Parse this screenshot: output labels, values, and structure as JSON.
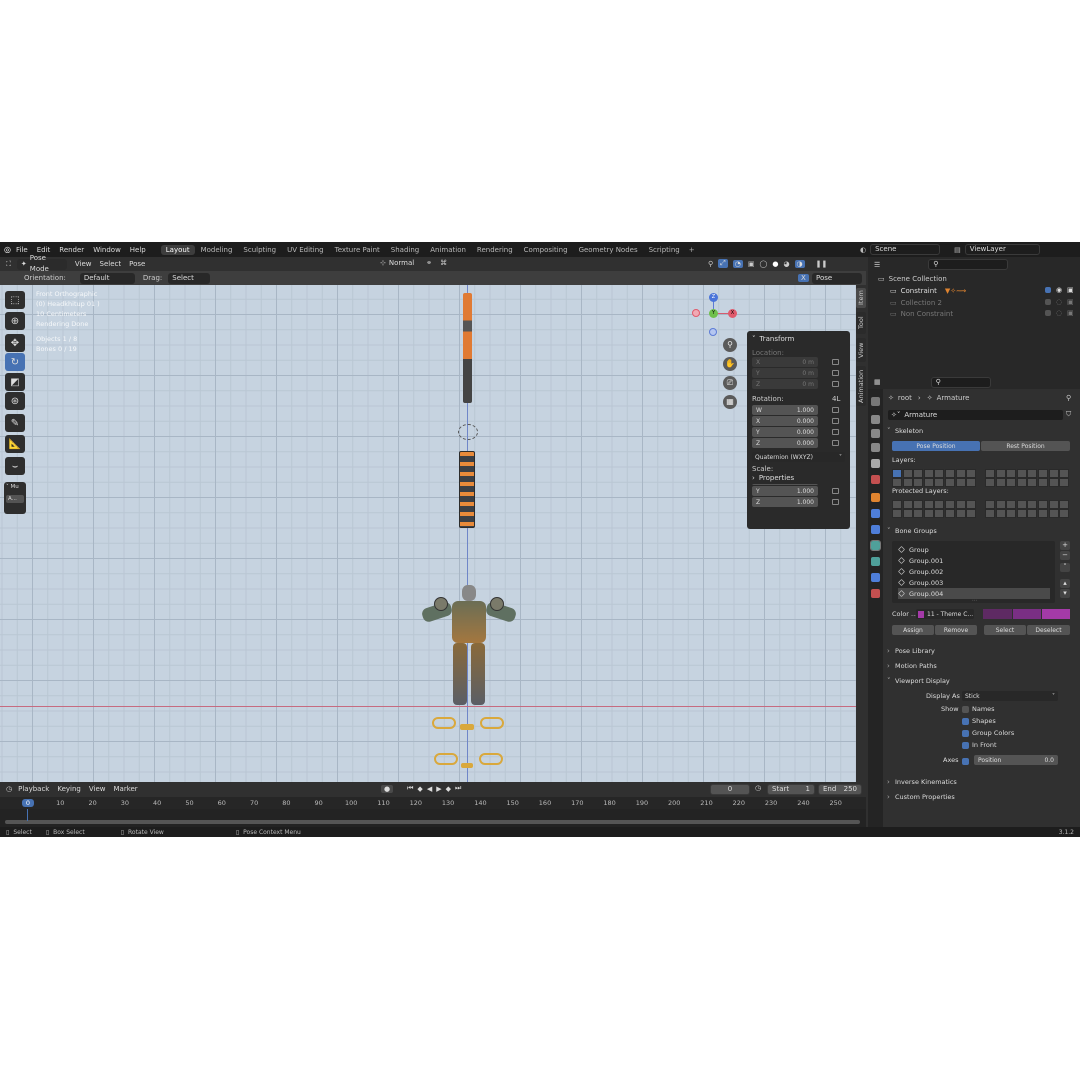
{
  "menu": [
    "File",
    "Edit",
    "Render",
    "Window",
    "Help"
  ],
  "workspaces": [
    "Layout",
    "Modeling",
    "Sculpting",
    "UV Editing",
    "Texture Paint",
    "Shading",
    "Animation",
    "Rendering",
    "Compositing",
    "Geometry Nodes",
    "Scripting"
  ],
  "active_workspace": "Layout",
  "add_workspace": "+",
  "scene": "Scene",
  "view_layer": "ViewLayer",
  "header": {
    "mode": "Pose Mode",
    "menus": [
      "View",
      "Select",
      "Pose"
    ],
    "pivot": "Normal"
  },
  "tool_header": {
    "orientation_label": "Orientation:",
    "orientation": "Default",
    "drag_label": "Drag:",
    "drag": "Select Box",
    "pose_options": "Pose Options",
    "x_label": "X"
  },
  "overlay_info": [
    "Front Orthographic",
    "(0) Headkhitup 01 )",
    "10 Centimeters",
    "Rendering Done",
    "",
    "Objects    1 / 8",
    "Bones      0 / 19"
  ],
  "gizmo": {
    "z": "Z",
    "y": "Y",
    "x": "X"
  },
  "last_op": "Mu",
  "last_op_short": "A...",
  "transform": {
    "title": "Transform",
    "location_label": "Location:",
    "location": [
      {
        "axis": "X",
        "value": "0 m"
      },
      {
        "axis": "Y",
        "value": "0 m"
      },
      {
        "axis": "Z",
        "value": "0 m"
      }
    ],
    "rotation_label": "Rotation:",
    "rotation_mode_short": "4L",
    "rotation": [
      {
        "axis": "W",
        "value": "1.000"
      },
      {
        "axis": "X",
        "value": "0.000"
      },
      {
        "axis": "Y",
        "value": "0.000"
      },
      {
        "axis": "Z",
        "value": "0.000"
      }
    ],
    "rotation_mode": "Quaternion (WXYZ)",
    "scale_label": "Scale:",
    "scale": [
      {
        "axis": "X",
        "value": "1.000"
      },
      {
        "axis": "Y",
        "value": "1.000"
      },
      {
        "axis": "Z",
        "value": "1.000"
      }
    ],
    "properties": "Properties"
  },
  "side_tabs": [
    "Item",
    "Tool",
    "View",
    "Animation"
  ],
  "timeline": {
    "menus": [
      "Playback",
      "Keying",
      "View",
      "Marker"
    ],
    "current_frame": "0",
    "start_label": "Start",
    "start": "1",
    "end_label": "End",
    "end": "250",
    "ticks": [
      "0",
      "10",
      "20",
      "30",
      "40",
      "50",
      "60",
      "70",
      "80",
      "90",
      "100",
      "110",
      "120",
      "130",
      "140",
      "150",
      "160",
      "170",
      "180",
      "190",
      "200",
      "210",
      "220",
      "230",
      "240",
      "250"
    ]
  },
  "status": {
    "select": "Select",
    "box_select": "Box Select",
    "rotate": "Rotate View",
    "context": "Pose Context Menu",
    "version": "3.1.2"
  },
  "outliner": {
    "root": "Scene Collection",
    "items": [
      {
        "name": "Constraint",
        "dim": false
      },
      {
        "name": "Collection 2",
        "dim": true
      },
      {
        "name": "Non Constraint",
        "dim": true
      }
    ]
  },
  "properties": {
    "breadcrumb_root": "root",
    "breadcrumb_item": "Armature",
    "data_name": "Armature",
    "skeleton": "Skeleton",
    "pose_position": "Pose Position",
    "rest_position": "Rest Position",
    "layers_label": "Layers:",
    "protected_label": "Protected Layers:",
    "bone_groups": "Bone Groups",
    "groups": [
      "Group",
      "Group.001",
      "Group.002",
      "Group.003",
      "Group.004"
    ],
    "selected_group": "Group.004",
    "color_label": "Color ...",
    "color_set": "11 - Theme C...",
    "assign": "Assign",
    "remove": "Remove",
    "select": "Select",
    "deselect": "Deselect",
    "pose_library": "Pose Library",
    "motion_paths": "Motion Paths",
    "viewport_display": "Viewport Display",
    "display_as_label": "Display As",
    "display_as": "Stick",
    "show_label": "Show",
    "names": "Names",
    "shapes": "Shapes",
    "group_colors": "Group Colors",
    "in_front": "In Front",
    "axes_label": "Axes",
    "axes_position": "Position",
    "axes_value": "0.0",
    "ik": "Inverse Kinematics",
    "custom": "Custom Properties"
  },
  "colors": {
    "accent": "#4772b3",
    "group_color_a": "#7a2f84",
    "group_color_b": "#a43aa8",
    "timeline_marker": "#4772b3"
  }
}
